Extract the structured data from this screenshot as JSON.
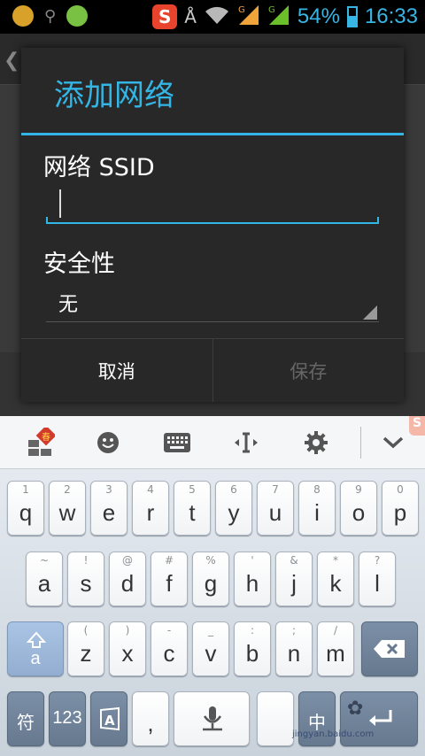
{
  "status_bar": {
    "battery": "54%",
    "time": "16:33",
    "network_label": "G",
    "icons": [
      "app-icon",
      "search-icon",
      "wechat-icon",
      "sogou-icon",
      "bluetooth-icon",
      "wifi-icon",
      "signal-icon",
      "signal-icon",
      "battery-icon"
    ]
  },
  "dialog": {
    "title": "添加网络",
    "ssid_label": "网络 SSID",
    "ssid_value": "",
    "security_label": "安全性",
    "security_value": "无",
    "cancel_label": "取消",
    "save_label": "保存"
  },
  "keyboard": {
    "toolbar_icons": [
      "spring-festival-icon",
      "emoji-icon",
      "keyboard-icon",
      "cursor-move-icon",
      "gear-icon",
      "chevron-down-icon"
    ],
    "row1": [
      {
        "main": "q",
        "sub": "1"
      },
      {
        "main": "w",
        "sub": "2"
      },
      {
        "main": "e",
        "sub": "3"
      },
      {
        "main": "r",
        "sub": "4"
      },
      {
        "main": "t",
        "sub": "5"
      },
      {
        "main": "y",
        "sub": "6"
      },
      {
        "main": "u",
        "sub": "7"
      },
      {
        "main": "i",
        "sub": "8"
      },
      {
        "main": "o",
        "sub": "9"
      },
      {
        "main": "p",
        "sub": "0"
      }
    ],
    "row2": [
      {
        "main": "a",
        "sub": "~"
      },
      {
        "main": "s",
        "sub": "!"
      },
      {
        "main": "d",
        "sub": "@"
      },
      {
        "main": "f",
        "sub": "#"
      },
      {
        "main": "g",
        "sub": "%"
      },
      {
        "main": "h",
        "sub": "'"
      },
      {
        "main": "j",
        "sub": "&"
      },
      {
        "main": "k",
        "sub": "*"
      },
      {
        "main": "l",
        "sub": "?"
      }
    ],
    "row3": [
      {
        "main": "z",
        "sub": "("
      },
      {
        "main": "x",
        "sub": ")"
      },
      {
        "main": "c",
        "sub": "-"
      },
      {
        "main": "v",
        "sub": "_"
      },
      {
        "main": "b",
        "sub": ":"
      },
      {
        "main": "n",
        "sub": ";"
      },
      {
        "main": "m",
        "sub": "/"
      }
    ],
    "shift_label": "a",
    "symbols_label": "符",
    "numbers_label": "123",
    "comma_label": ",",
    "cn_label": "中",
    "watermark": "jingyan.baidu.com"
  },
  "colors": {
    "accent": "#33b5e5",
    "dialog_bg": "#282828"
  }
}
